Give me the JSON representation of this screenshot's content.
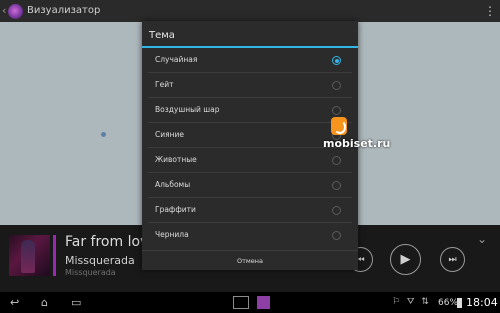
{
  "app": {
    "title": "Визуализатор",
    "overflow_icon": "more-vert-icon",
    "back_icon": "chevron-left-icon"
  },
  "dialog": {
    "title": "Тема",
    "accent": "#33b5e5",
    "options": [
      {
        "label": "Случайная",
        "selected": true
      },
      {
        "label": "Гейт",
        "selected": false
      },
      {
        "label": "Воздушный шар",
        "selected": false
      },
      {
        "label": "Сияние",
        "selected": false
      },
      {
        "label": "Животные",
        "selected": false
      },
      {
        "label": "Альбомы",
        "selected": false
      },
      {
        "label": "Граффити",
        "selected": false
      },
      {
        "label": "Чернила",
        "selected": false
      }
    ],
    "cancel_label": "Отмена"
  },
  "now_playing": {
    "track_title": "Far from love",
    "artist": "Missquerada",
    "album": "Missquerada",
    "accent": "#9c27b0",
    "controls": {
      "prev_icon": "skip-previous-icon",
      "play_icon": "play-icon",
      "next_icon": "skip-next-icon",
      "collapse_icon": "chevron-down-icon"
    }
  },
  "status_bar": {
    "nav": {
      "back_icon": "↩",
      "home_icon": "⌂",
      "recents_icon": "▭"
    },
    "icons": "⚐ ⛛ ⇅",
    "battery": "66%",
    "time": "18:04"
  },
  "watermark": {
    "text": "mobiset.ru"
  }
}
